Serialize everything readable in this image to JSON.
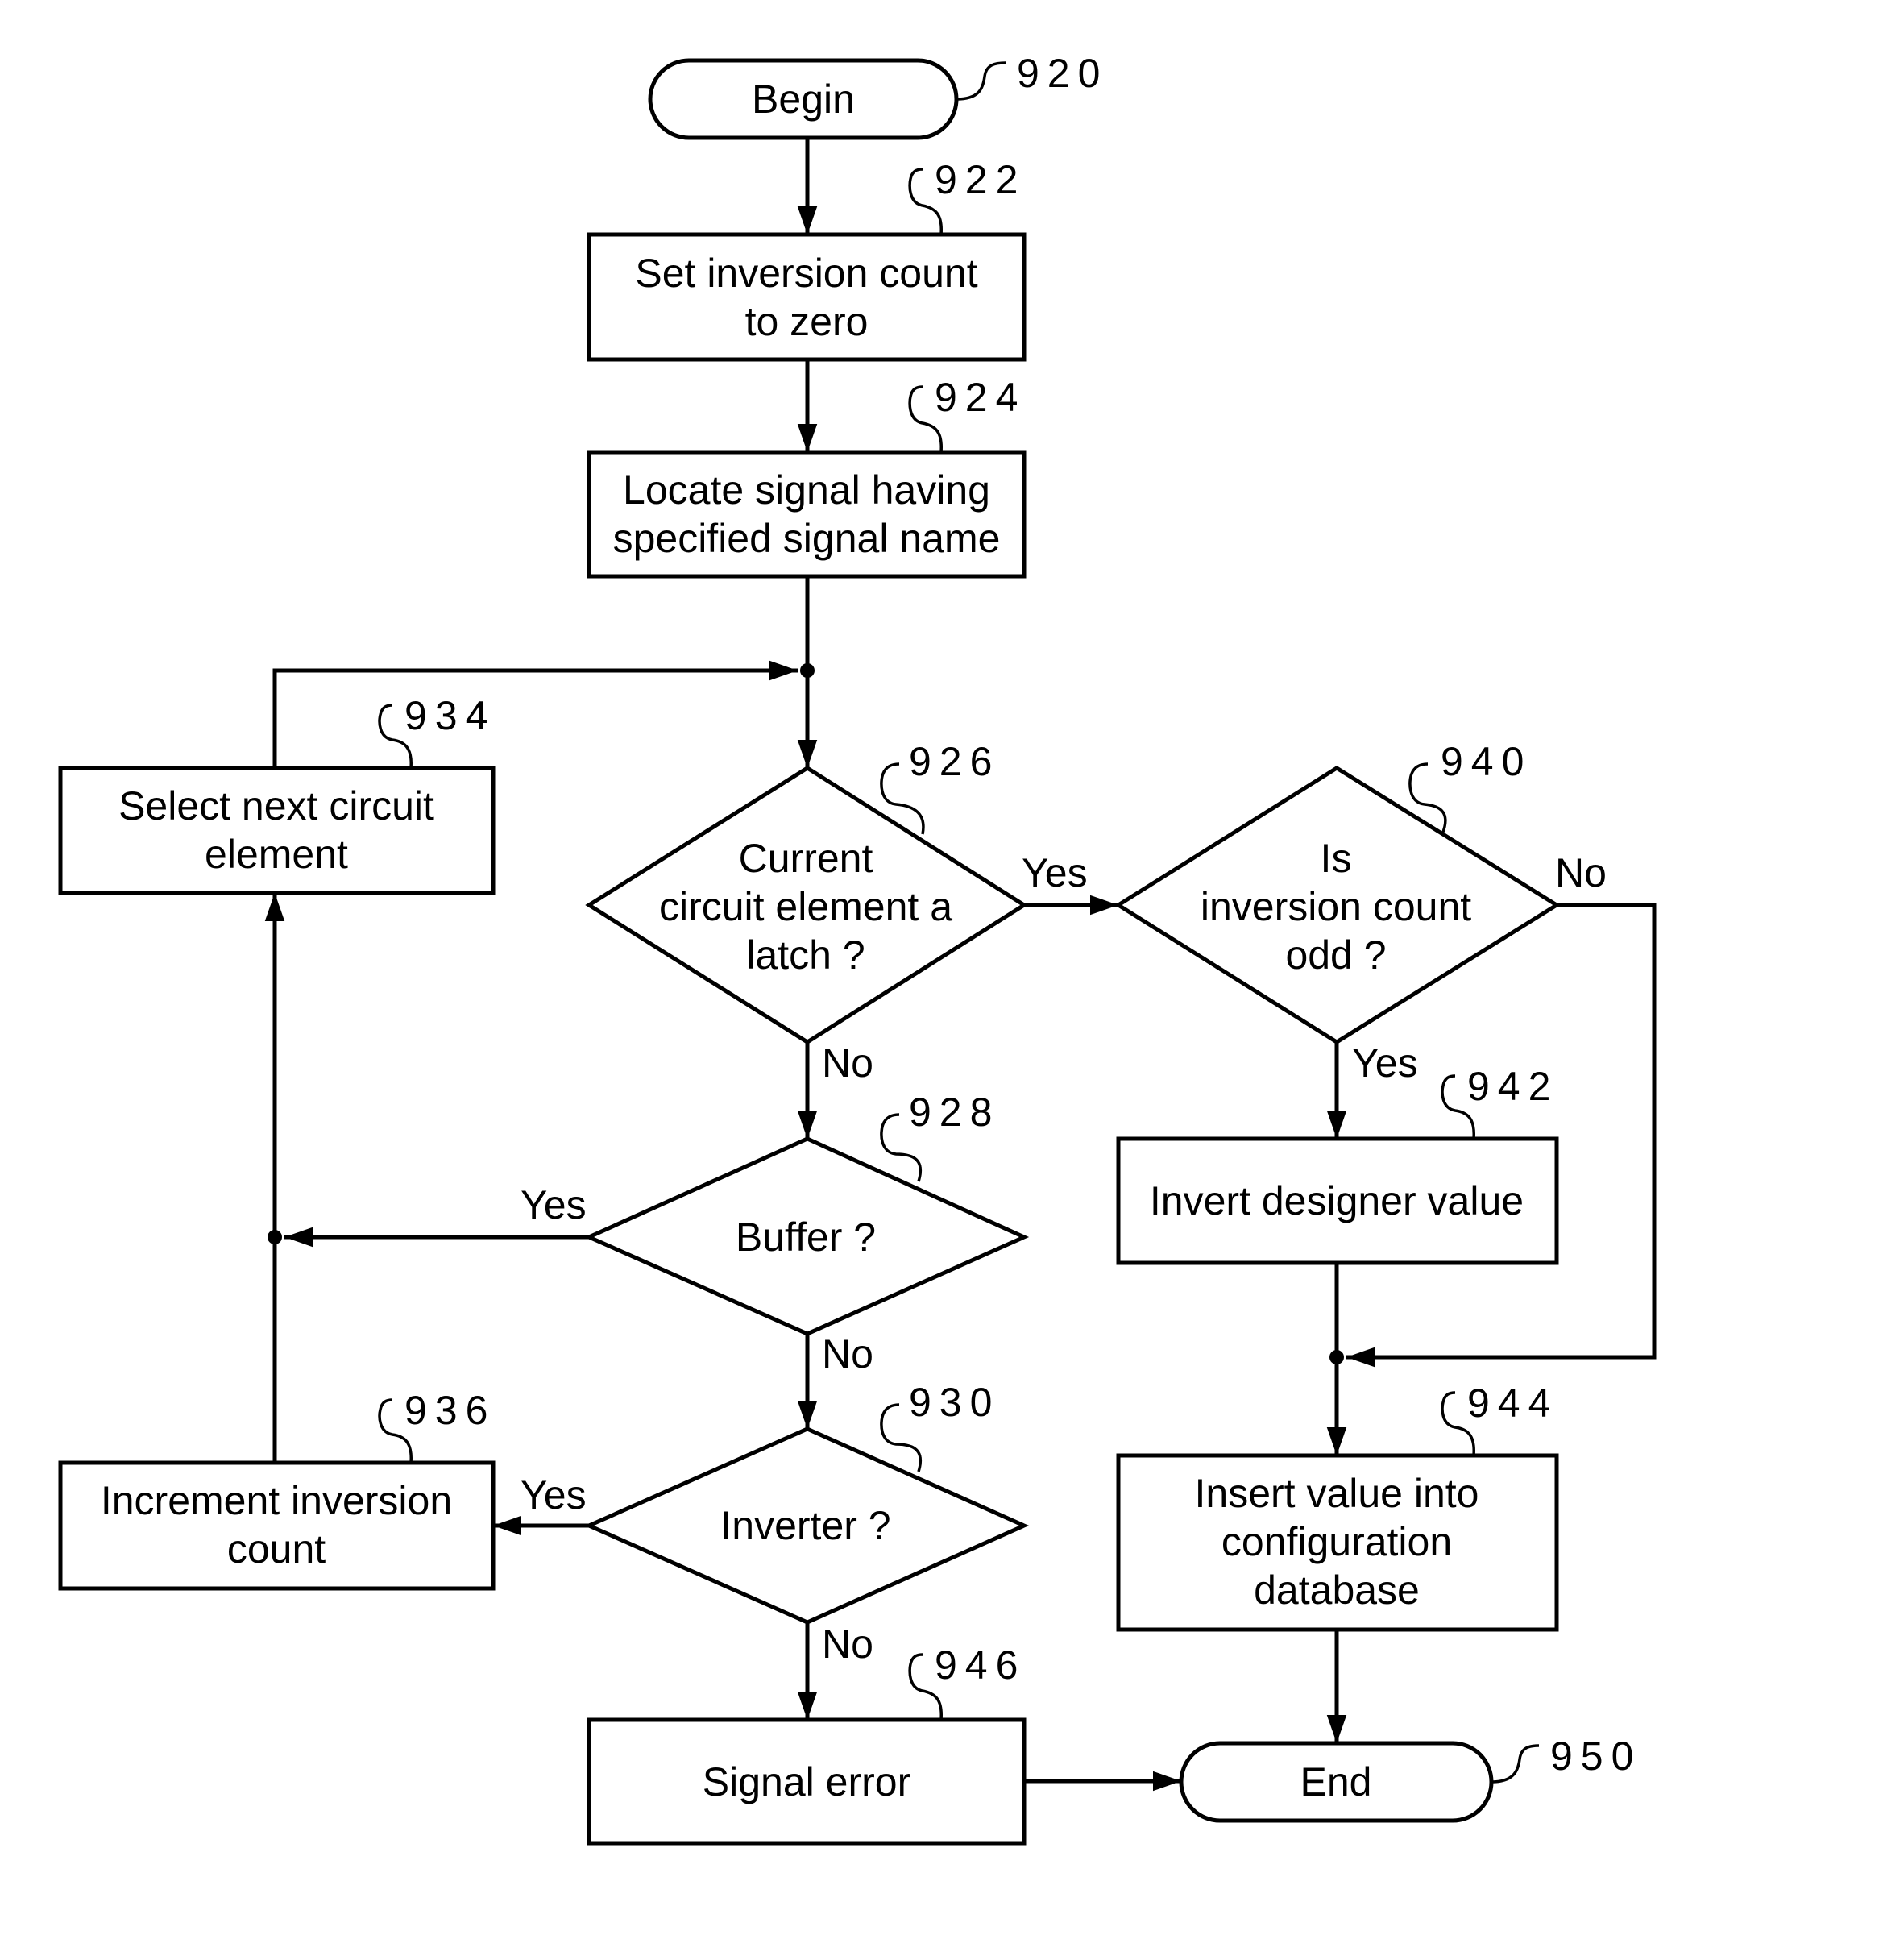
{
  "diagram": {
    "type": "flowchart",
    "nodes": {
      "begin": {
        "ref": "920",
        "shape": "terminal",
        "lines": [
          "Begin"
        ]
      },
      "set_count": {
        "ref": "922",
        "shape": "process",
        "lines": [
          "Set inversion count",
          "to zero"
        ]
      },
      "locate_signal": {
        "ref": "924",
        "shape": "process",
        "lines": [
          "Locate signal having",
          "specified signal name"
        ]
      },
      "is_latch": {
        "ref": "926",
        "shape": "decision",
        "lines": [
          "Current",
          "circuit element a",
          "latch ?"
        ]
      },
      "is_buffer": {
        "ref": "928",
        "shape": "decision",
        "lines": [
          "Buffer ?"
        ]
      },
      "is_inverter": {
        "ref": "930",
        "shape": "decision",
        "lines": [
          "Inverter ?"
        ]
      },
      "select_next": {
        "ref": "934",
        "shape": "process",
        "lines": [
          "Select next circuit",
          "element"
        ]
      },
      "increment_count": {
        "ref": "936",
        "shape": "process",
        "lines": [
          "Increment inversion",
          "count"
        ]
      },
      "is_odd": {
        "ref": "940",
        "shape": "decision",
        "lines": [
          "Is",
          "inversion count",
          "odd ?"
        ]
      },
      "invert_value": {
        "ref": "942",
        "shape": "process",
        "lines": [
          "Invert designer value"
        ]
      },
      "insert_value": {
        "ref": "944",
        "shape": "process",
        "lines": [
          "Insert value into",
          "configuration",
          "database"
        ]
      },
      "signal_error": {
        "ref": "946",
        "shape": "process",
        "lines": [
          "Signal error"
        ]
      },
      "end": {
        "ref": "950",
        "shape": "terminal",
        "lines": [
          "End"
        ]
      }
    },
    "edge_labels": {
      "latch_yes": "Yes",
      "latch_no": "No",
      "buffer_yes": "Yes",
      "buffer_no": "No",
      "inverter_yes": "Yes",
      "inverter_no": "No",
      "odd_yes": "Yes",
      "odd_no": "No"
    },
    "edges": [
      {
        "from": "begin",
        "to": "set_count"
      },
      {
        "from": "set_count",
        "to": "locate_signal"
      },
      {
        "from": "locate_signal",
        "to": "is_latch"
      },
      {
        "from": "is_latch",
        "to": "is_odd",
        "label": "Yes"
      },
      {
        "from": "is_latch",
        "to": "is_buffer",
        "label": "No"
      },
      {
        "from": "is_buffer",
        "to": "select_next",
        "label": "Yes"
      },
      {
        "from": "is_buffer",
        "to": "is_inverter",
        "label": "No"
      },
      {
        "from": "is_inverter",
        "to": "increment_count",
        "label": "Yes"
      },
      {
        "from": "is_inverter",
        "to": "signal_error",
        "label": "No"
      },
      {
        "from": "increment_count",
        "to": "select_next"
      },
      {
        "from": "select_next",
        "to": "is_latch"
      },
      {
        "from": "is_odd",
        "to": "invert_value",
        "label": "Yes"
      },
      {
        "from": "is_odd",
        "to": "insert_value",
        "label": "No"
      },
      {
        "from": "invert_value",
        "to": "insert_value"
      },
      {
        "from": "insert_value",
        "to": "end"
      },
      {
        "from": "signal_error",
        "to": "end"
      }
    ]
  }
}
